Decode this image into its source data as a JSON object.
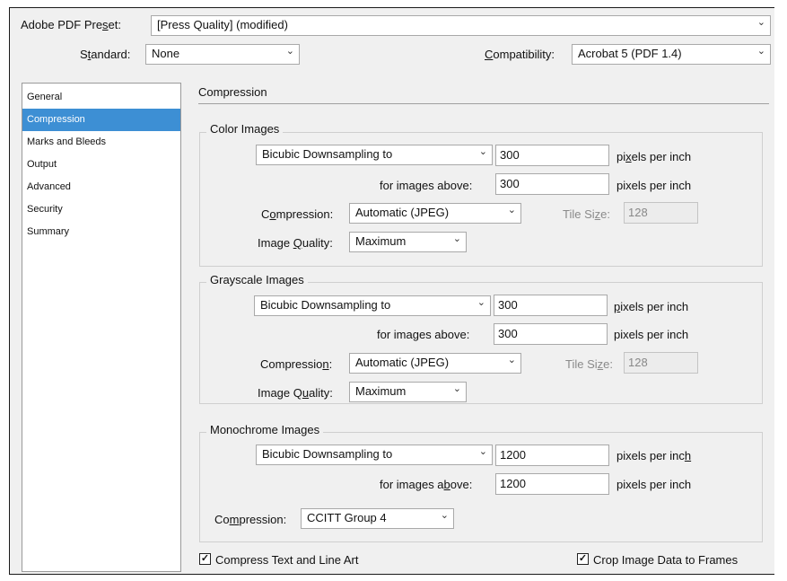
{
  "preset": {
    "label": "Adobe PDF Preset:",
    "value": "[Press Quality] (modified)"
  },
  "standard": {
    "label": "Standard:",
    "value": "None"
  },
  "compatibility": {
    "label": "Compatibility:",
    "value": "Acrobat 5 (PDF 1.4)"
  },
  "sidebar": {
    "items": [
      {
        "label": "General"
      },
      {
        "label": "Compression"
      },
      {
        "label": "Marks and Bleeds"
      },
      {
        "label": "Output"
      },
      {
        "label": "Advanced"
      },
      {
        "label": "Security"
      },
      {
        "label": "Summary"
      }
    ],
    "selected": "Compression"
  },
  "panel": {
    "title": "Compression"
  },
  "color": {
    "title": "Color Images",
    "method": "Bicubic Downsampling to",
    "ppi": "300",
    "ppi_unit": "pixels per inch",
    "above_label": "for images above:",
    "above_value": "300",
    "above_unit": "pixels per inch",
    "compression_label": "Compression:",
    "compression_value": "Automatic (JPEG)",
    "tile_label": "Tile Size:",
    "tile_value": "128",
    "quality_label": "Image Quality:",
    "quality_value": "Maximum"
  },
  "gray": {
    "title": "Grayscale Images",
    "method": "Bicubic Downsampling to",
    "ppi": "300",
    "ppi_unit": "pixels per inch",
    "above_label": "for images above:",
    "above_value": "300",
    "above_unit": "pixels per inch",
    "compression_label": "Compression:",
    "compression_value": "Automatic (JPEG)",
    "tile_label": "Tile Size:",
    "tile_value": "128",
    "quality_label": "Image Quality:",
    "quality_value": "Maximum"
  },
  "mono": {
    "title": "Monochrome Images",
    "method": "Bicubic Downsampling to",
    "ppi": "1200",
    "ppi_unit": "pixels per inch",
    "above_label": "for images above:",
    "above_value": "1200",
    "above_unit": "pixels per inch",
    "compression_label": "Compression:",
    "compression_value": "CCITT Group 4"
  },
  "options": {
    "compress_text": {
      "label": "Compress Text and Line Art",
      "checked": true
    },
    "crop_image": {
      "label": "Crop Image Data to Frames",
      "checked": true
    }
  },
  "icons": {
    "dropdown": "chevron-down-icon",
    "check": "checkmark-icon"
  },
  "colors": {
    "selection": "#3d8fd4",
    "dialog_bg": "#f0f0f0"
  }
}
